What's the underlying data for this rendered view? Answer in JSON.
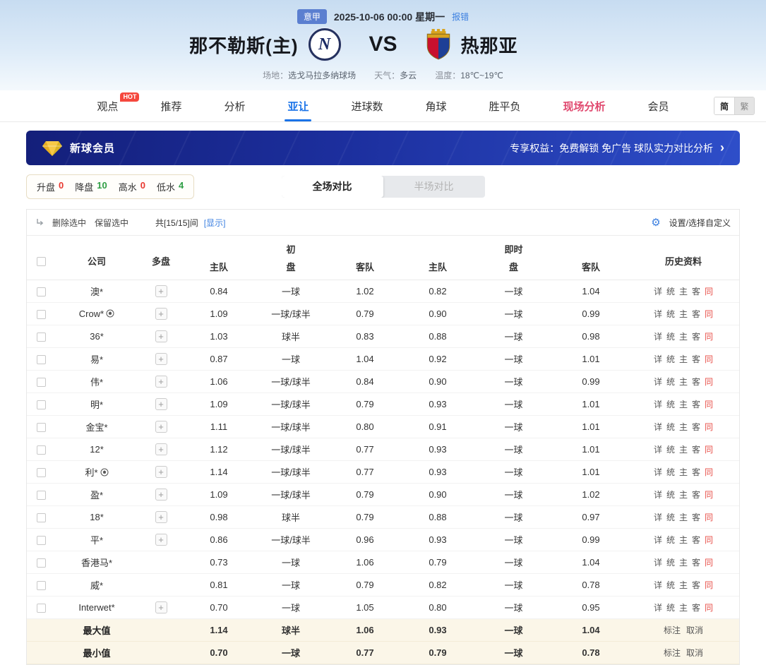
{
  "header": {
    "league_badge": "意甲",
    "datetime": "2025-10-06 00:00 星期一",
    "report_error": "报错",
    "home_team": "那不勒斯(主)",
    "home_logo_letter": "N",
    "vs": "VS",
    "away_team": "热那亚",
    "venue_label": "场地：",
    "venue": "选戈马拉多纳球场",
    "weather_label": "天气：",
    "weather": "多云",
    "temp_label": "温度：",
    "temp": "18℃~19℃"
  },
  "nav": {
    "hot_badge": "HOT",
    "items": [
      {
        "id": "viewpoint",
        "label": "观点",
        "hot": true
      },
      {
        "id": "recommend",
        "label": "推荐"
      },
      {
        "id": "analysis",
        "label": "分析"
      },
      {
        "id": "asian-handicap",
        "label": "亚让",
        "active": true
      },
      {
        "id": "goals",
        "label": "进球数"
      },
      {
        "id": "corner",
        "label": "角球"
      },
      {
        "id": "win-draw-lose",
        "label": "胜平负"
      },
      {
        "id": "live-analysis",
        "label": "现场分析",
        "highlight": true
      },
      {
        "id": "member",
        "label": "会员"
      }
    ],
    "lang": [
      {
        "id": "simplified",
        "label": "简",
        "active": true
      },
      {
        "id": "traditional",
        "label": "繁",
        "active": false
      }
    ]
  },
  "banner": {
    "title": "新球会员",
    "benefits": "专享权益：免费解锁 免广告 球队实力对比分析",
    "arrow": "›"
  },
  "filters": {
    "stats": [
      {
        "id": "rise",
        "label": "升盘",
        "value": "0",
        "color": "#e8382f"
      },
      {
        "id": "drop",
        "label": "降盘",
        "value": "10",
        "color": "#2f9e44"
      },
      {
        "id": "high-water",
        "label": "高水",
        "value": "0",
        "color": "#e8382f"
      },
      {
        "id": "low-water",
        "label": "低水",
        "value": "4",
        "color": "#2f9e44"
      }
    ],
    "tabs": [
      {
        "id": "full-match",
        "label": "全场对比",
        "active": true
      },
      {
        "id": "half-match",
        "label": "半场对比",
        "active": false
      }
    ]
  },
  "toolbar": {
    "delete_selected": "删除选中",
    "keep_selected": "保留选中",
    "count_text": "共[15/15]间",
    "show_link": "[显示]",
    "settings": "设置/选择自定义"
  },
  "table": {
    "plus_label": "+",
    "headers": {
      "company": "公司",
      "multi": "多盘",
      "initial_group": "初",
      "live_group": "即时",
      "home": "主队",
      "handicap": "盘",
      "away": "客队",
      "history": "历史资料"
    },
    "history_links": [
      {
        "id": "detail",
        "label": "详"
      },
      {
        "id": "stats",
        "label": "统"
      },
      {
        "id": "home",
        "label": "主"
      },
      {
        "id": "away",
        "label": "客"
      },
      {
        "id": "same",
        "label": "同",
        "accent": true
      }
    ],
    "summary_actions": [
      {
        "id": "mark",
        "label": "标注"
      },
      {
        "id": "cancel",
        "label": "取消"
      }
    ],
    "rows": [
      {
        "company": "澳*",
        "ball": false,
        "multi": true,
        "init": [
          "0.84",
          "一球",
          "1.02"
        ],
        "live": [
          "0.82",
          "一球",
          "1.04"
        ]
      },
      {
        "company": "Crow*",
        "ball": true,
        "multi": true,
        "init": [
          "1.09",
          "一球/球半",
          "0.79"
        ],
        "live": [
          "0.90",
          "一球",
          "0.99"
        ]
      },
      {
        "company": "36*",
        "ball": false,
        "multi": true,
        "init": [
          "1.03",
          "球半",
          "0.83"
        ],
        "live": [
          "0.88",
          "一球",
          "0.98"
        ]
      },
      {
        "company": "易*",
        "ball": false,
        "multi": true,
        "init": [
          "0.87",
          "一球",
          "1.04"
        ],
        "live": [
          "0.92",
          "一球",
          "1.01"
        ]
      },
      {
        "company": "伟*",
        "ball": false,
        "multi": true,
        "init": [
          "1.06",
          "一球/球半",
          "0.84"
        ],
        "live": [
          "0.90",
          "一球",
          "0.99"
        ]
      },
      {
        "company": "明*",
        "ball": false,
        "multi": true,
        "init": [
          "1.09",
          "一球/球半",
          "0.79"
        ],
        "live": [
          "0.93",
          "一球",
          "1.01"
        ]
      },
      {
        "company": "金宝*",
        "ball": false,
        "multi": true,
        "init": [
          "1.11",
          "一球/球半",
          "0.80"
        ],
        "live": [
          "0.91",
          "一球",
          "1.01"
        ]
      },
      {
        "company": "12*",
        "ball": false,
        "multi": true,
        "init": [
          "1.12",
          "一球/球半",
          "0.77"
        ],
        "live": [
          "0.93",
          "一球",
          "1.01"
        ]
      },
      {
        "company": "利*",
        "ball": true,
        "multi": true,
        "init": [
          "1.14",
          "一球/球半",
          "0.77"
        ],
        "live": [
          "0.93",
          "一球",
          "1.01"
        ]
      },
      {
        "company": "盈*",
        "ball": false,
        "multi": true,
        "init": [
          "1.09",
          "一球/球半",
          "0.79"
        ],
        "live": [
          "0.90",
          "一球",
          "1.02"
        ]
      },
      {
        "company": "18*",
        "ball": false,
        "multi": true,
        "init": [
          "0.98",
          "球半",
          "0.79"
        ],
        "live": [
          "0.88",
          "一球",
          "0.97"
        ]
      },
      {
        "company": "平*",
        "ball": false,
        "multi": true,
        "init": [
          "0.86",
          "一球/球半",
          "0.96"
        ],
        "live": [
          "0.93",
          "一球",
          "0.99"
        ]
      },
      {
        "company": "香港马*",
        "ball": false,
        "multi": false,
        "init": [
          "0.73",
          "一球",
          "1.06"
        ],
        "live": [
          "0.79",
          "一球",
          "1.04"
        ]
      },
      {
        "company": "威*",
        "ball": false,
        "multi": false,
        "init": [
          "0.81",
          "一球",
          "0.79"
        ],
        "live": [
          "0.82",
          "一球",
          "0.78"
        ]
      },
      {
        "company": "Interwet*",
        "ball": false,
        "multi": true,
        "init": [
          "0.70",
          "一球",
          "1.05"
        ],
        "live": [
          "0.80",
          "一球",
          "0.95"
        ]
      }
    ],
    "summary": [
      {
        "id": "max",
        "label": "最大值",
        "init": [
          "1.14",
          "球半",
          "1.06"
        ],
        "live": [
          "0.93",
          "一球",
          "1.04"
        ]
      },
      {
        "id": "min",
        "label": "最小值",
        "init": [
          "0.70",
          "一球",
          "0.77"
        ],
        "live": [
          "0.79",
          "一球",
          "0.78"
        ]
      }
    ]
  }
}
